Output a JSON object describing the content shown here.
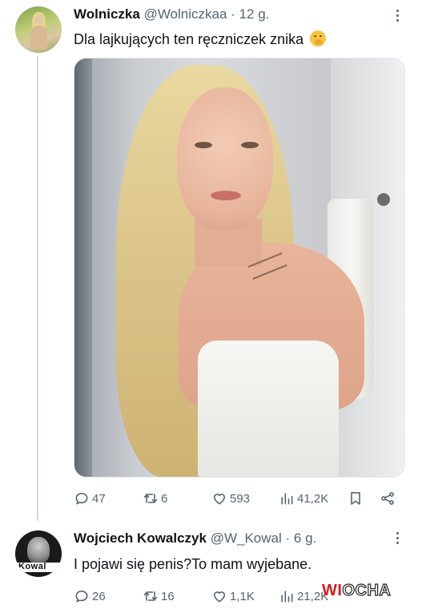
{
  "tweets": [
    {
      "author_name": "Wolniczka",
      "handle": "@Wolniczkaa",
      "separator": "·",
      "time": "12 g.",
      "text": "Dla lajkujących ten ręczniczek znika",
      "emoji": "face-with-hand-over-mouth",
      "stats": {
        "replies": "47",
        "retweets": "6",
        "likes": "593",
        "views": "41,2K"
      }
    },
    {
      "author_name": "Wojciech Kowalczyk",
      "handle": "@W_Kowal",
      "separator": "·",
      "time": "6 g.",
      "text": "I pojawi się penis?To mam wyjebane.",
      "avatar_caption": "Kowal",
      "stats": {
        "replies": "26",
        "retweets": "16",
        "likes": "1,1K",
        "views": "21,2K"
      }
    }
  ],
  "watermark": {
    "part1": "WI",
    "part2": "OCHA"
  },
  "colors": {
    "text": "#0f1419",
    "secondary": "#536471",
    "thread_line": "#cfd9de",
    "watermark_red": "#d91c1c"
  }
}
